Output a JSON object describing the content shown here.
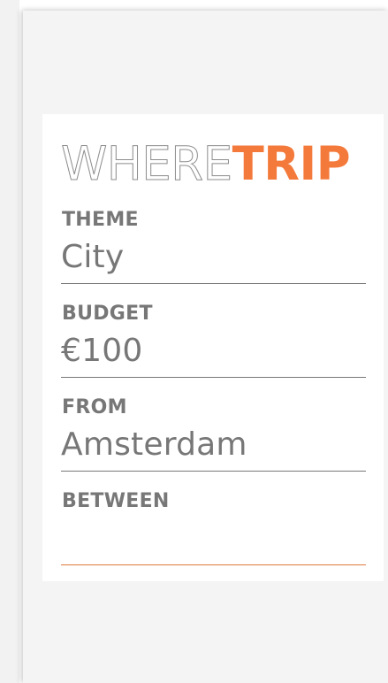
{
  "brand": {
    "word_light": "WHERE",
    "word_bold": "TRIP",
    "accent_color": "#f47a3c"
  },
  "form": {
    "fields": [
      {
        "label": "THEME",
        "value": "City"
      },
      {
        "label": "BUDGET",
        "value": "€100"
      },
      {
        "label": "FROM",
        "value": "Amsterdam"
      },
      {
        "label": "BETWEEN",
        "value": ""
      }
    ]
  },
  "colors": {
    "label_text": "#777777",
    "panel_background": "#f4f4f4",
    "card_background": "#ffffff",
    "active_underline": "#e07a3f"
  }
}
